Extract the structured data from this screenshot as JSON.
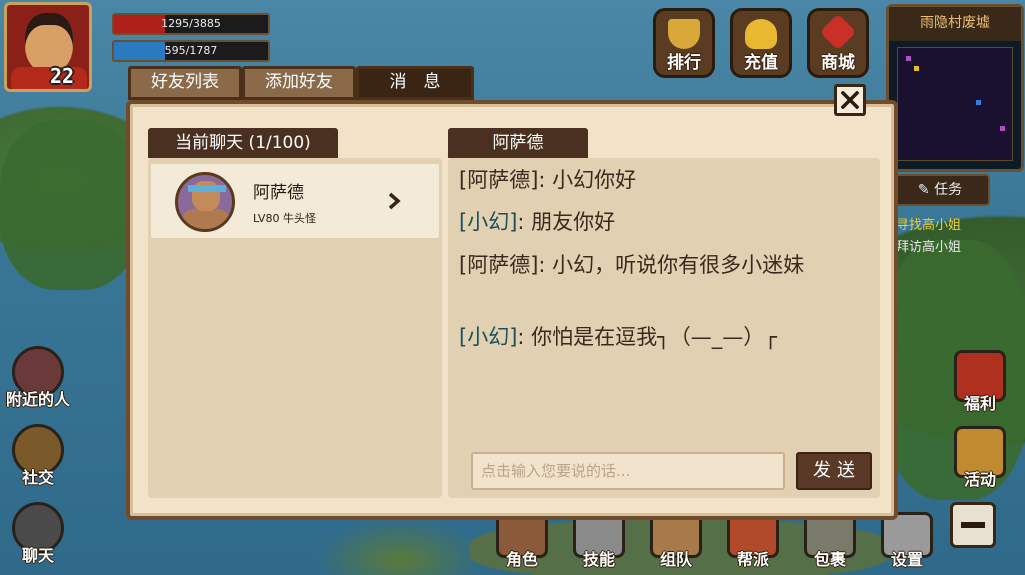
{
  "hud": {
    "level": "22",
    "hp": {
      "text": "1295/3885",
      "fraction": 0.333
    },
    "mp": {
      "text": "595/1787",
      "fraction": 0.333
    }
  },
  "top_menu": [
    {
      "label": "排行",
      "icon": "trophy-icon"
    },
    {
      "label": "充值",
      "icon": "gold-ingot-icon"
    },
    {
      "label": "商城",
      "icon": "shop-gem-icon"
    }
  ],
  "minimap": {
    "title": "雨隐村废墟"
  },
  "quest": {
    "button_label": "任务",
    "line1": "寻找高小姐",
    "line2": "拜访高小姐"
  },
  "left_menu": [
    {
      "label": "附近的人",
      "icon": "flag-icon"
    },
    {
      "label": "社交",
      "icon": "helmet-icon"
    },
    {
      "label": "聊天",
      "icon": "chat-bubble-icon"
    }
  ],
  "right_menu": [
    {
      "label": "福利",
      "icon": "gift-icon"
    },
    {
      "label": "活动",
      "icon": "event-icon"
    }
  ],
  "bottom_menu": [
    {
      "label": "角色",
      "icon": "character-icon"
    },
    {
      "label": "技能",
      "icon": "swords-icon"
    },
    {
      "label": "组队",
      "icon": "handshake-icon"
    },
    {
      "label": "帮派",
      "icon": "banner-icon"
    },
    {
      "label": "包裹",
      "icon": "bag-icon"
    },
    {
      "label": "设置",
      "icon": "wrench-icon"
    }
  ],
  "dialog": {
    "tabs": [
      {
        "label": "好友列表",
        "active": false
      },
      {
        "label": "添加好友",
        "active": false
      },
      {
        "label": "消　息",
        "active": true
      }
    ],
    "friends_header": "当前聊天 (1/100)",
    "friends": [
      {
        "name": "阿萨德",
        "detail": "LV80 牛头怪"
      }
    ],
    "chat_header": "阿萨德",
    "messages": [
      {
        "sender": "[阿萨德]",
        "text": ": 小幻你好",
        "self": false
      },
      {
        "sender": "[小幻]",
        "text": ": 朋友你好",
        "self": true
      },
      {
        "sender": "[阿萨德]",
        "text": ": 小幻，听说你有很多小迷妹",
        "self": false
      },
      {
        "sender": "[小幻]",
        "text": ": 你怕是在逗我┐（—_—）┌",
        "self": true
      }
    ],
    "input_placeholder": "点击输入您要说的话...",
    "send_label": "发送"
  },
  "colors": {
    "panel_bg": "#f2e2c8",
    "dark_brown": "#4a3020",
    "self_name": "#1e5058"
  }
}
